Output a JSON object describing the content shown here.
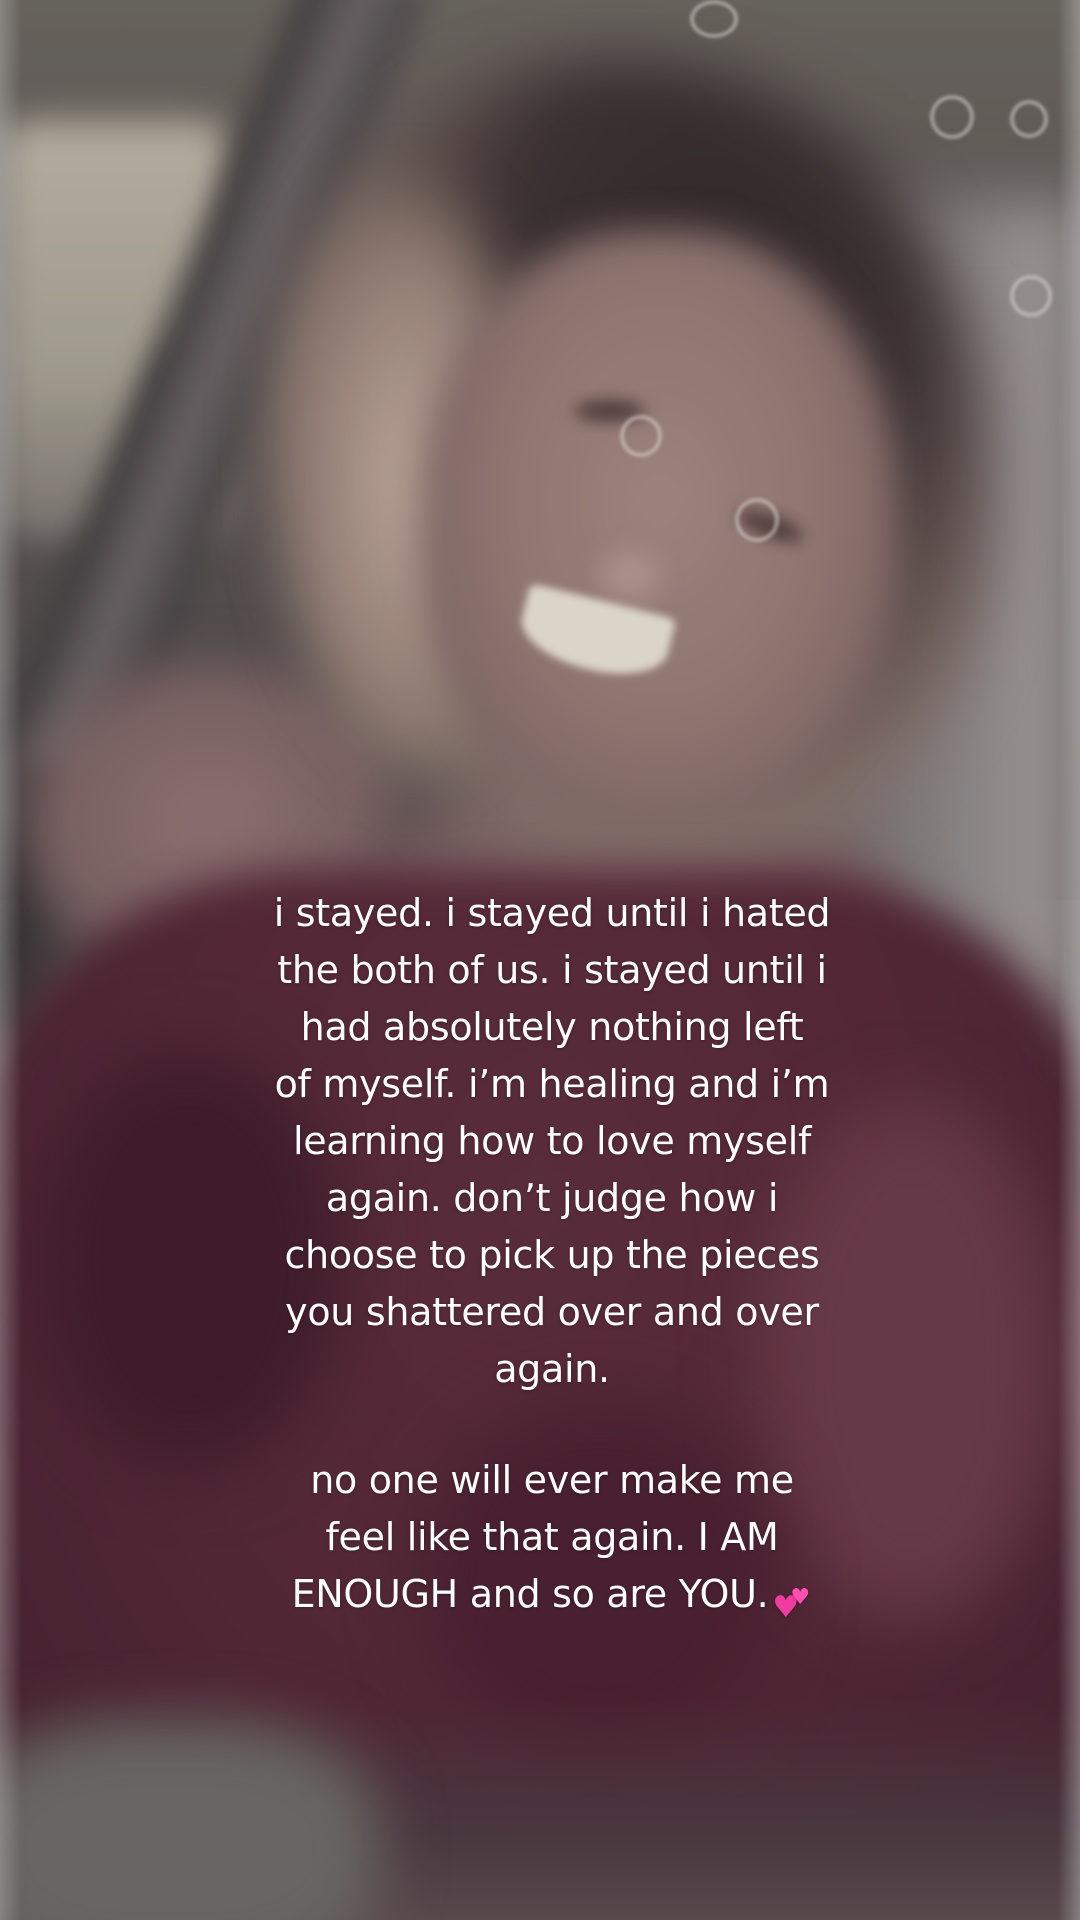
{
  "caption": {
    "paragraph_1": "i stayed. i stayed until i hated\nthe both of us. i stayed until i\nhad absolutely nothing left\nof myself. i’m healing and i’m\nlearning how to love myself\nagain. don’t judge how i\nchoose to pick up the pieces\nyou shattered over and over\nagain.",
    "paragraph_2": "no one will ever make me\nfeel like that again. I AM\nENOUGH and so are YOU.",
    "emoji": "two-hearts-emoji"
  },
  "colors": {
    "text": "#ffffff",
    "garment": "#552737",
    "heart": "#f03ca0"
  }
}
